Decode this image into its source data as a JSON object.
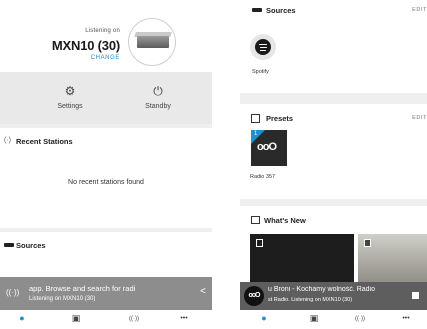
{
  "left": {
    "device": {
      "listening_label": "Listening on",
      "name": "MXN10 (30)",
      "change_label": "CHANGE"
    },
    "controls": {
      "settings_label": "Settings",
      "standby_label": "Standby"
    },
    "recent": {
      "title": "Recent Stations",
      "empty": "No recent stations found"
    },
    "sources": {
      "title": "Sources"
    },
    "now_playing": {
      "title": "app.  Browse and search for radi",
      "subtitle": "Listening on MXN10 (30)"
    }
  },
  "right": {
    "sources": {
      "title": "Sources",
      "edit": "EDIT",
      "items": [
        {
          "label": "Spotify",
          "icon": "spotify-icon"
        }
      ]
    },
    "presets": {
      "title": "Presets",
      "edit": "EDIT",
      "items": [
        {
          "number": "1",
          "logo": "ooO",
          "label": "Radio 357"
        }
      ]
    },
    "news": {
      "title": "What's New"
    },
    "now_playing": {
      "art": "ooO",
      "title": "u Broni - Kochamy wolność. Radio",
      "subtitle": "st Radio. Listening on MXN10 (30)"
    }
  },
  "tabbar": {
    "items": [
      {
        "icon": "home-icon",
        "glyph": "●",
        "active": true
      },
      {
        "icon": "library-icon",
        "glyph": "▣",
        "active": false
      },
      {
        "icon": "radio-icon",
        "glyph": "((·))",
        "active": false
      },
      {
        "icon": "more-icon",
        "glyph": "•••",
        "active": false
      }
    ]
  },
  "colors": {
    "accent": "#1f8fcf",
    "background": "#efefef",
    "now_playing_left": "#8d8d8d",
    "now_playing_right": "#5e5e5e"
  }
}
